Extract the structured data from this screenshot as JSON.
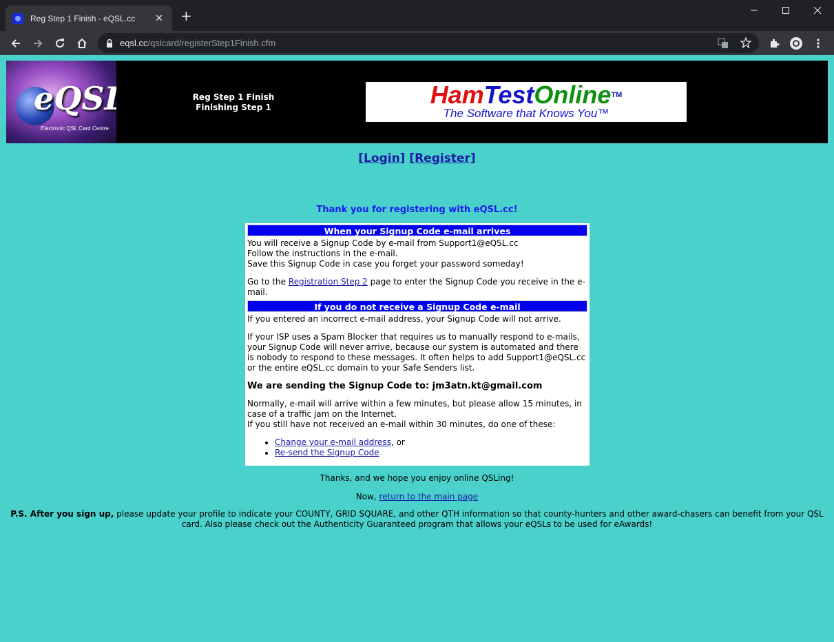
{
  "browser": {
    "tab_title": "Reg Step 1 Finish - eQSL.cc",
    "url_host": "eqsl.cc",
    "url_path": "/qslcard/registerStep1Finish.cfm"
  },
  "banner": {
    "logo_text": "eQSL",
    "logo_sub": "Electronic QSL Card Centre",
    "title_line1": "Reg Step 1 Finish",
    "title_line2": "Finishing Step 1",
    "ad_ham": "Ham",
    "ad_test": "Test",
    "ad_online": "Online",
    "ad_tm": "TM",
    "ad_sub": "The Software that Knows You™"
  },
  "nav": {
    "login": "[Login]",
    "register": "[Register]"
  },
  "thanks_heading": "Thank you for registering with eQSL.cc!",
  "box": {
    "head1": "When your Signup Code e-mail arrives",
    "line1": "You will receive a Signup Code by e-mail from Support1@eQSL.cc",
    "line2": "Follow the instructions in the e-mail.",
    "line3": "Save this Signup Code in case you forget your password someday!",
    "goto_pre": "Go to the ",
    "goto_link": "Registration Step 2",
    "goto_post": " page to enter the Signup Code you receive in the e-mail.",
    "head2": "If you do not receive a Signup Code e-mail",
    "incorrect": "If you entered an incorrect e-mail address, your Signup Code will not arrive.",
    "spam": "If your ISP uses a Spam Blocker that requires us to manually respond to e-mails, your Signup Code will never arrive, because our system is automated and there is nobody to respond to these messages. It often helps to add Support1@eQSL.cc or the entire eQSL.cc domain to your Safe Senders list.",
    "sending": "We are sending the Signup Code to: jm3atn.kt@gmail.com",
    "normally": "Normally, e-mail will arrive within a few minutes, but please allow 15 minutes, in case of a traffic jam on the Internet.",
    "still": "If you still have not received an e-mail within 30 minutes, do one of these:",
    "opt1_link": "Change your e-mail address",
    "opt1_post": ", or",
    "opt2_link": "Re-send the Signup Code"
  },
  "footer": {
    "thanks": "Thanks, and we hope you enjoy online QSLing!",
    "now_pre": "Now, ",
    "now_link": "return to the main page",
    "ps_bold": "P.S. After you sign up,",
    "ps_text": " please update your profile to indicate your COUNTY, GRID SQUARE, and other QTH information so that county-hunters and other award-chasers can benefit from your QSL card. Also please check out the Authenticity Guaranteed program that allows your eQSLs to be used for eAwards!"
  }
}
